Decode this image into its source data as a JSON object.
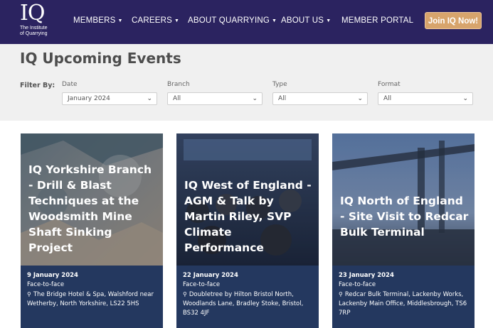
{
  "header": {
    "logo_mark": "IQ",
    "logo_sub_1": "The Institute",
    "logo_sub_2": "of Quarrying",
    "nav": [
      {
        "label": "MEMBERS",
        "has_dropdown": true
      },
      {
        "label": "CAREERS",
        "has_dropdown": true
      },
      {
        "label": "ABOUT QUARRYING",
        "has_dropdown": true
      },
      {
        "label": "ABOUT US",
        "has_dropdown": true
      },
      {
        "label": "MEMBER PORTAL",
        "has_dropdown": false
      }
    ],
    "join_label": "Join IQ Now!",
    "chevron_glyph": "▼",
    "colors": {
      "background": "#2b2360",
      "join_button": "#d7a46c"
    }
  },
  "filters": {
    "page_title": "IQ Upcoming Events",
    "filter_by_label": "Filter By:",
    "date": {
      "label": "Date",
      "value": "January 2024"
    },
    "branch": {
      "label": "Branch",
      "value": "All"
    },
    "type": {
      "label": "Type",
      "value": "All"
    },
    "format": {
      "label": "Format",
      "value": "All"
    },
    "chevron_glyph": "⌄"
  },
  "events": [
    {
      "title": "IQ Yorkshire Branch - Drill & Blast Techniques at the Woodsmith Mine Shaft Sinking Project",
      "date": "9 January 2024",
      "format": "Face-to-face",
      "location": "The Bridge Hotel & Spa, Walshford near Wetherby, North Yorkshire, LS22 5HS",
      "pin_glyph": "⚲"
    },
    {
      "title": "IQ West of England - AGM & Talk by Martin Riley, SVP Climate Performance",
      "date": "22 January 2024",
      "format": "Face-to-face",
      "location": "Doubletree by Hilton Bristol North, Woodlands Lane, Bradley Stoke, Bristol, BS32 4JF",
      "pin_glyph": "⚲"
    },
    {
      "title": "IQ North of England - Site Visit to Redcar Bulk Terminal",
      "date": "23 January 2024",
      "format": "Face-to-face",
      "location": "Redcar Bulk Terminal, Lackenby Works, Lackenby Main Office, Middlesbrough, TS6 7RP",
      "pin_glyph": "⚲"
    }
  ],
  "card_info_color": "#24385f"
}
